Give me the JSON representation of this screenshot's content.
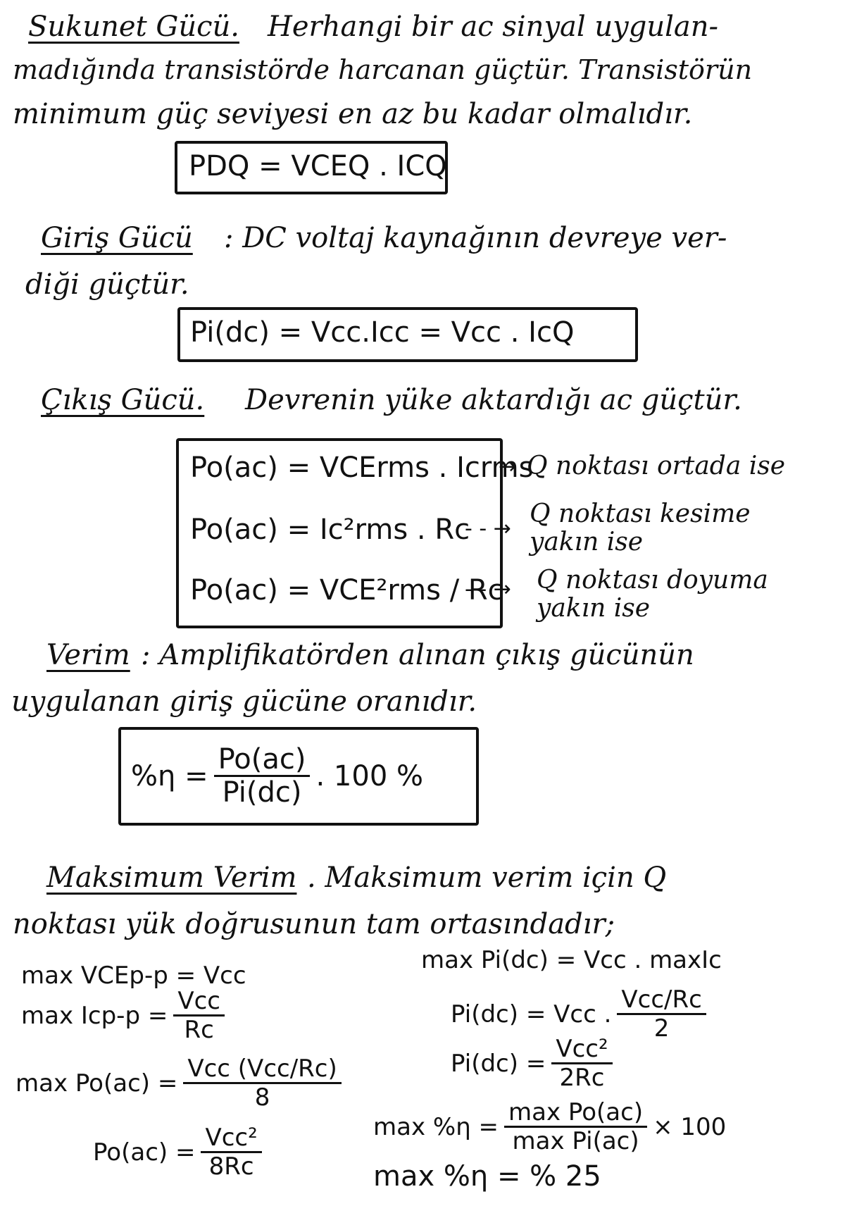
{
  "sections": {
    "sukunet": {
      "heading": "Sukunet Gücü.",
      "line1": "Herhangi bir ac sinyal uygulan-",
      "line2": "madığında transistörde harcanan güçtür. Transistörün",
      "line3": "minimum güç seviyesi en az bu kadar olmalıdır.",
      "formula": "PDQ = VCEQ . ICQ"
    },
    "giris": {
      "heading": "Giriş Gücü",
      "line1": ": DC voltaj kaynağının devreye ver-",
      "line2": "diği güçtür.",
      "formula": "Pi(dc) = Vcc.Icc = Vcc . IcQ"
    },
    "cikis": {
      "heading": "Çıkış Gücü.",
      "line1": "Devrenin yüke aktardığı ac güçtür.",
      "f1": "Po(ac) = VCErms . Icrms",
      "f2": "Po(ac) = Ic²rms . Rc",
      "f3": "Po(ac) = VCE²rms / Rc",
      "n1": "Q noktası ortada ise",
      "n2a": "Q noktası kesime",
      "n2b": "yakın ise",
      "n3a": "Q noktası doyuma",
      "n3b": "yakın ise"
    },
    "verim": {
      "heading": "Verim",
      "line1": ": Amplifikatörden alınan çıkış gücünün",
      "line2": "uygulanan giriş gücüne oranıdır.",
      "lhs": "%η =",
      "num": "Po(ac)",
      "den": "Pi(dc)",
      "rhs": ". 100 %"
    },
    "max": {
      "heading": "Maksimum Verim",
      "line1": ". Maksimum verim için Q",
      "line2": "noktası yük doğrusunun tam ortasındadır;",
      "l1": "max VCEp-p = Vcc",
      "l2a": "max Icp-p =",
      "l2n": "Vcc",
      "l2d": "Rc",
      "l3a": "max Po(ac) =",
      "l3n": "Vcc (Vcc/Rc)",
      "l3d": "8",
      "l4a": "Po(ac) =",
      "l4n": "Vcc²",
      "l4d": "8Rc",
      "r1": "max Pi(dc) = Vcc . maxIc",
      "r2a": "Pi(dc) = Vcc .",
      "r2n": "Vcc/Rc",
      "r2d": "2",
      "r3a": "Pi(dc) =",
      "r3n": "Vcc²",
      "r3d": "2Rc",
      "r4a": "max %η =",
      "r4n": "max Po(ac)",
      "r4d": "max Pi(ac)",
      "r4b": "× 100",
      "r5": "max %η = % 25"
    }
  }
}
